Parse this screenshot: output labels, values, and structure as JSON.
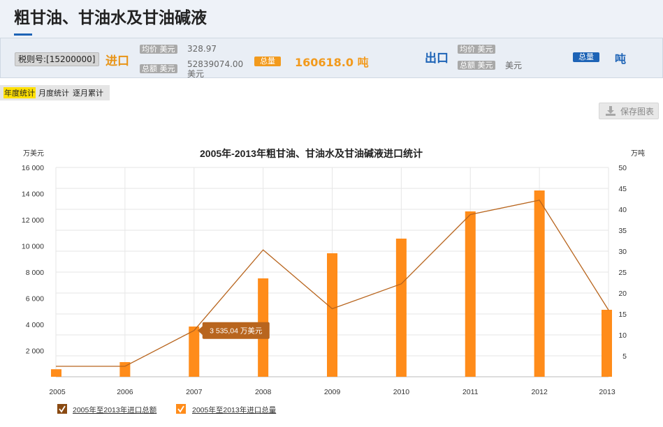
{
  "page": {
    "title": "粗甘油、甘油水及甘油碱液"
  },
  "info_bar": {
    "tax_code": "税则号:[15200000]",
    "import": {
      "label": "进口",
      "avg_price_label": "均价 美元",
      "avg_price_value": "328.97",
      "total_label": "总额 美元",
      "total_value": "52839074.00",
      "total_unit": "美元",
      "qty_label": "总量",
      "qty_value": "160618.0 吨"
    },
    "export": {
      "label": "出口",
      "avg_price_label": "均价 美元",
      "total_label": "总额 美元",
      "total_unit": "美元",
      "qty_label": "总量",
      "qty_unit": "吨"
    }
  },
  "tabs": [
    {
      "label": "年度统计",
      "active": true
    },
    {
      "label": "月度统计",
      "active": false
    },
    {
      "label": "逐月累计",
      "active": false
    }
  ],
  "toolbar": {
    "save_label": "保存图表",
    "save_icon": "download-icon"
  },
  "colors": {
    "bar": "#ff8c1a",
    "line": "#b8651e",
    "tooltip": "#b8651e",
    "legend_total": "#8a4a12",
    "legend_qty": "#ff8c1a"
  },
  "chart_data": {
    "type": "bar",
    "title": "2005年-2013年粗甘油、甘油水及甘油碱液进口统计",
    "categories": [
      "2005",
      "2006",
      "2007",
      "2008",
      "2009",
      "2010",
      "2011",
      "2012",
      "2013"
    ],
    "left_axis": {
      "unit": "万美元",
      "range": [
        0,
        16000
      ],
      "ticks": [
        "2 000",
        "4 000",
        "6 000",
        "8 000",
        "10 000",
        "12 000",
        "14 000",
        "16 000"
      ],
      "tick_values": [
        2000,
        4000,
        6000,
        8000,
        10000,
        12000,
        14000,
        16000
      ]
    },
    "right_axis": {
      "unit": "万吨",
      "range": [
        0,
        50
      ],
      "ticks": [
        "5",
        "10",
        "15",
        "20",
        "25",
        "30",
        "35",
        "40",
        "45",
        "50"
      ],
      "tick_values": [
        5,
        10,
        15,
        20,
        25,
        30,
        35,
        40,
        45,
        50
      ]
    },
    "series": [
      {
        "name": "2005年至2013年进口总额",
        "type": "line",
        "axis": "left",
        "values": [
          800,
          800,
          3535.04,
          9700,
          5200,
          7100,
          12400,
          13500,
          5100
        ]
      },
      {
        "name": "2005年至2013年进口总量",
        "type": "bar",
        "axis": "right",
        "values": [
          1.8,
          3.5,
          12.0,
          23.5,
          29.5,
          33.0,
          39.5,
          44.5,
          16.0
        ]
      }
    ],
    "tooltip": {
      "category": "2007",
      "text": "3 535,04 万美元"
    },
    "grid": true,
    "legend_position": "bottom-left"
  }
}
